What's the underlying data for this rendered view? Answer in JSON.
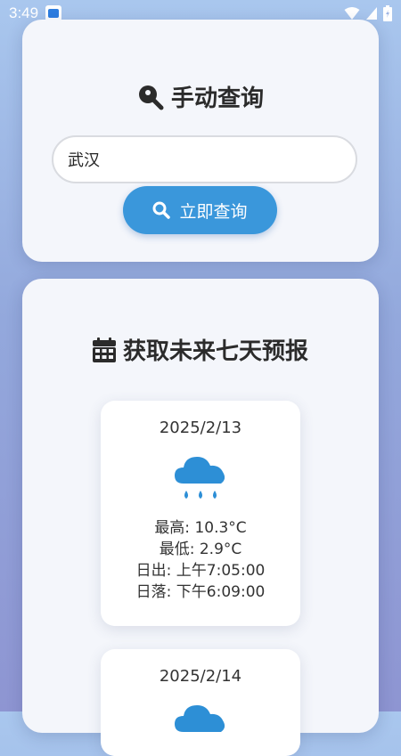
{
  "status_bar": {
    "time": "3:49"
  },
  "manual_query": {
    "title": "手动查询",
    "input_value": "武汉",
    "button_label": "立即查询"
  },
  "forecast": {
    "title": "获取未来七天预报",
    "days": [
      {
        "date": "2025/2/13",
        "icon": "rain-cloud-icon",
        "high": "最高: 10.3°C",
        "low": "最低: 2.9°C",
        "sunrise": "日出: 上午7:05:00",
        "sunset": "日落: 下午6:09:00"
      },
      {
        "date": "2025/2/14",
        "icon": "rain-cloud-icon"
      }
    ]
  },
  "colors": {
    "accent": "#3a97db",
    "icon": "#2d8fd6"
  }
}
